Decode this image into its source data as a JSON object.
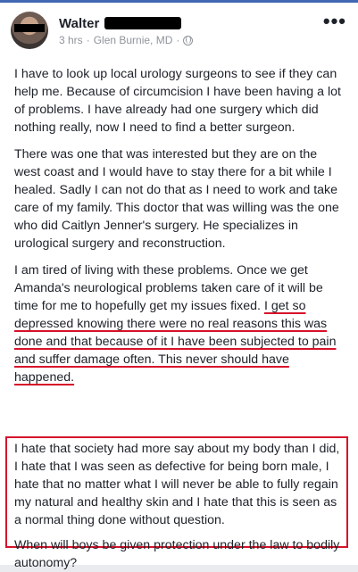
{
  "post": {
    "author_name": "Walter",
    "time": "3 hrs",
    "location": "Glen Burnie, MD",
    "separator": "·",
    "privacy_icon": "globe-icon",
    "more_icon": "more-horizontal-icon",
    "more_label": "•••",
    "paragraphs": [
      "I have to look up local urology surgeons to see if they can help me. Because of circumcision I have been having a lot of problems. I have already had one surgery which did nothing really, now I need to find a better surgeon.",
      "There was one that was interested but they are on the west coast and I would have to stay there for a bit while I healed. Sadly I can not do that as I need to work and take care of my family. This doctor that was willing was the one who did Caitlyn Jenner's surgery. He specializes in urological surgery and reconstruction."
    ],
    "paragraph3_plain": "I am tired of living with these problems. Once we get Amanda's neurological problems taken care of it will be time for me to hopefully get my issues fixed. ",
    "paragraph3_underlined": "I get so depressed knowing there were no real reasons this was done and that because of it I have been subjected to pain and suffer damage often. This never should have happened.",
    "boxed_paragraphs": [
      "I hate that society had more say about my body than I did, I hate that I was seen as defective for being born male, I hate that no matter what I will never be able to fully regain my natural and healthy skin and I hate that this is seen as a normal thing done without question.",
      "When will boys be given protection under the law to bodily autonomy?"
    ]
  },
  "colors": {
    "highlight": "#d6112a",
    "brand": "#4267b2"
  }
}
